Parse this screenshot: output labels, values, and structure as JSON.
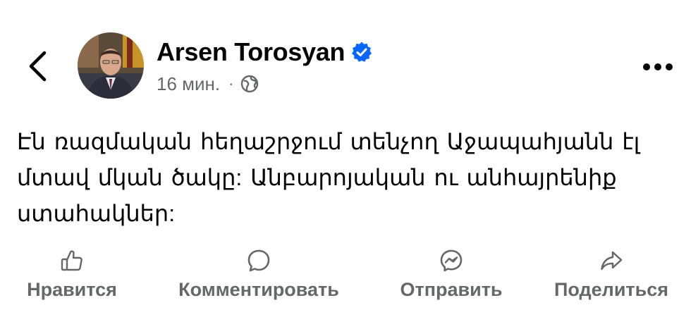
{
  "post": {
    "author": {
      "name": "Arsen Torosyan",
      "verified": true,
      "verified_icon": "verified-badge-icon",
      "avatar_icon": "profile-photo"
    },
    "time": "16 мин.",
    "separator": "·",
    "audience_icon": "globe-icon",
    "text": "Էն ռազմական հեղաշրջում տենչող Աջապահյանն էլ մտավ մկան ծակը: Անբարոյական ու անհայրենիք ստահակներ:"
  },
  "header": {
    "back_icon": "chevron-left-icon",
    "more_icon": "more-horizontal-icon"
  },
  "actions": [
    {
      "label": "Нравится",
      "icon": "thumbs-up-icon"
    },
    {
      "label": "Комментировать",
      "icon": "comment-icon"
    },
    {
      "label": "Отправить",
      "icon": "messenger-icon"
    },
    {
      "label": "Поделиться",
      "icon": "share-icon"
    }
  ],
  "colors": {
    "text": "#050505",
    "secondary": "#65676b",
    "verified": "#0866ff"
  }
}
